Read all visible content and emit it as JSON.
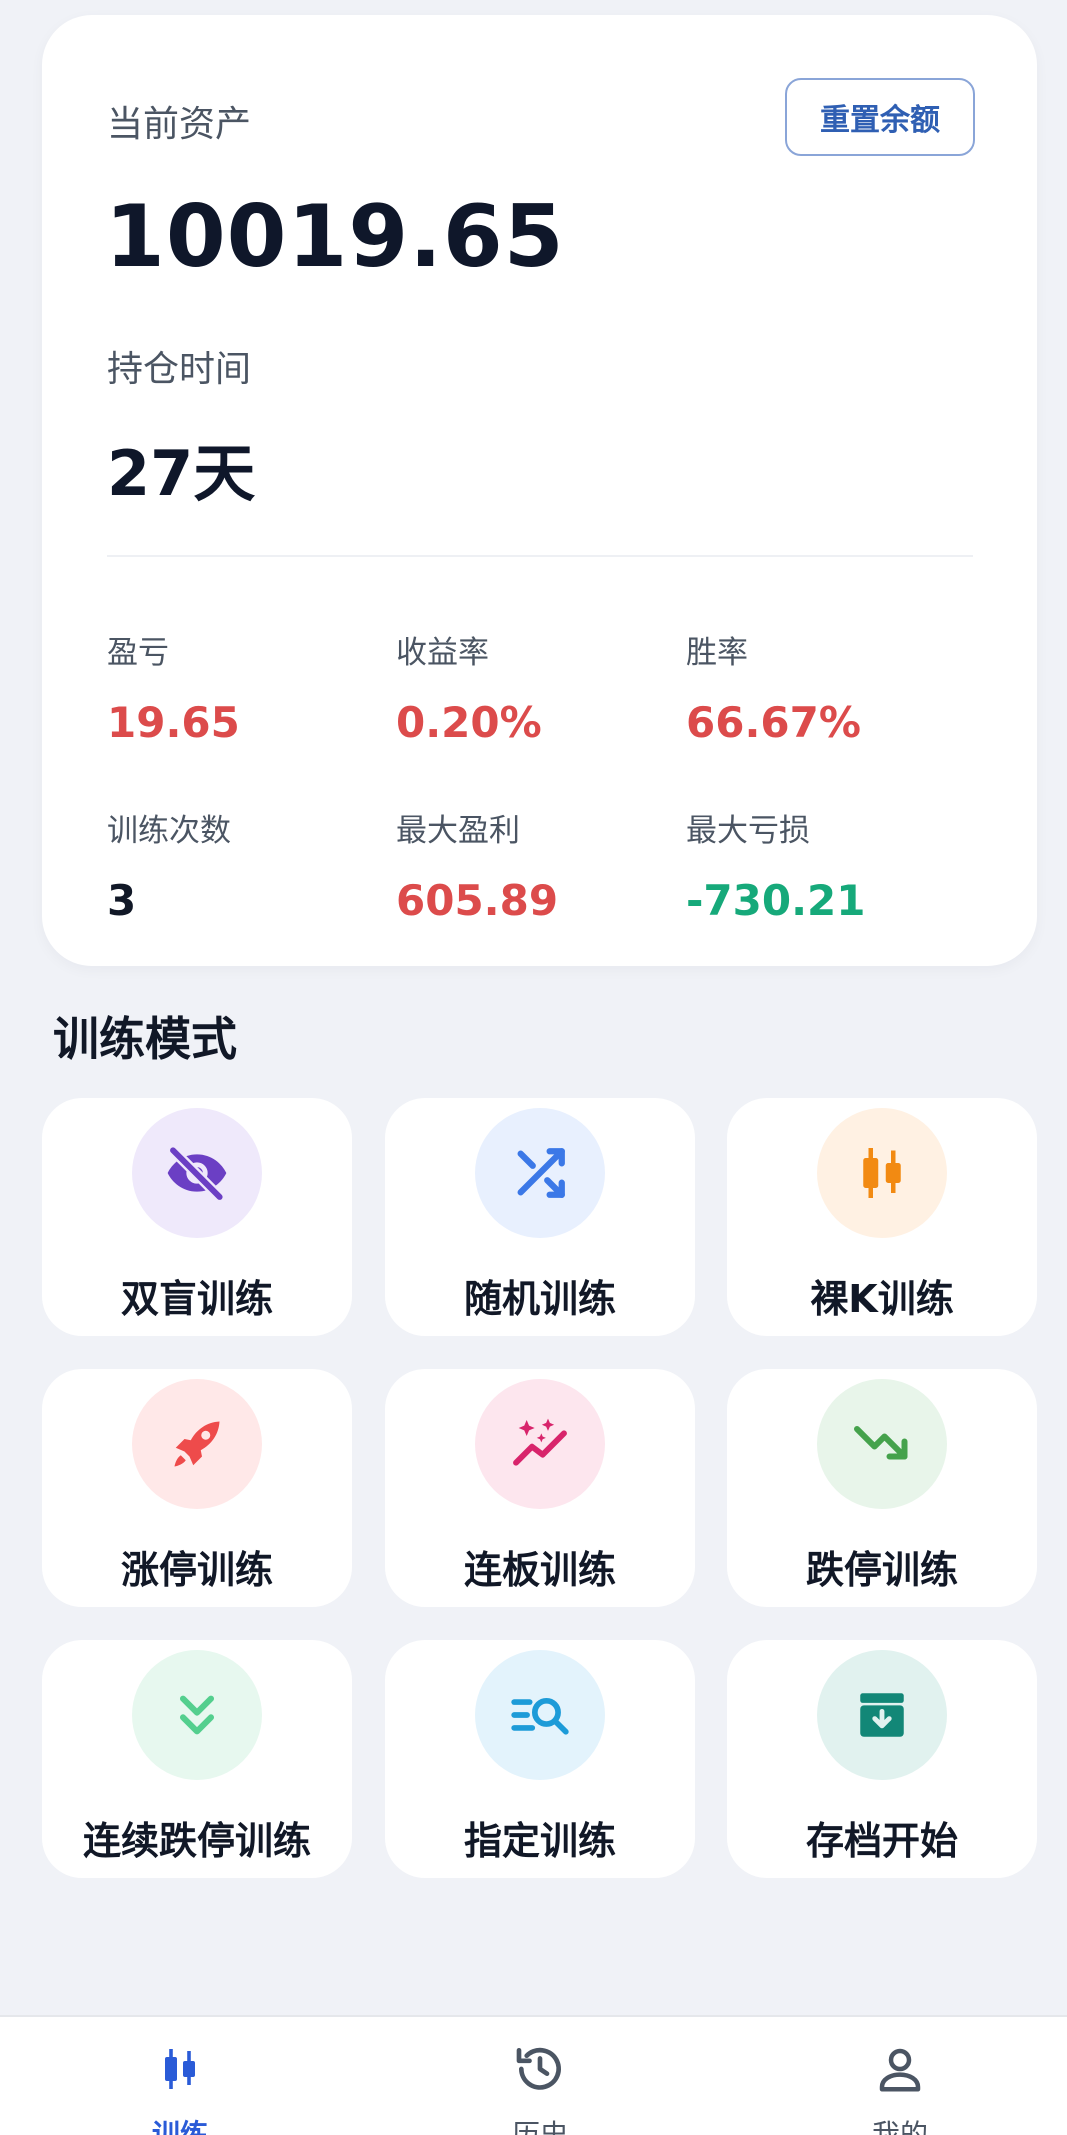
{
  "asset": {
    "label": "当前资产",
    "value": "10019.65",
    "reset_label": "重置余额",
    "hold_label": "持仓时间",
    "hold_value": "27天"
  },
  "stats": [
    {
      "label": "盈亏",
      "value": "19.65",
      "tone": "red"
    },
    {
      "label": "收益率",
      "value": "0.20%",
      "tone": "red"
    },
    {
      "label": "胜率",
      "value": "66.67%",
      "tone": "red"
    },
    {
      "label": "训练次数",
      "value": "3",
      "tone": "dark"
    },
    {
      "label": "最大盈利",
      "value": "605.89",
      "tone": "red"
    },
    {
      "label": "最大亏损",
      "value": "-730.21",
      "tone": "green"
    }
  ],
  "section": {
    "title": "训练模式"
  },
  "modes": [
    {
      "label": "双盲训练",
      "icon": "eye-slash-icon",
      "bg": "#efe9fb",
      "fg": "#6b3fc4"
    },
    {
      "label": "随机训练",
      "icon": "shuffle-icon",
      "bg": "#e8f0fe",
      "fg": "#3b78e7"
    },
    {
      "label": "裸K训练",
      "icon": "candlestick-icon",
      "bg": "#fff1e3",
      "fg": "#f28a12"
    },
    {
      "label": "涨停训练",
      "icon": "rocket-icon",
      "bg": "#ffe8e8",
      "fg": "#ee4b4b"
    },
    {
      "label": "连板训练",
      "icon": "sparkle-trend-icon",
      "bg": "#fde6ee",
      "fg": "#d8246b"
    },
    {
      "label": "跌停训练",
      "icon": "trending-down-icon",
      "bg": "#e8f5ea",
      "fg": "#45a24c"
    },
    {
      "label": "连续跌停训练",
      "icon": "double-chevron-down-icon",
      "bg": "#e7f8ef",
      "fg": "#54cf8e"
    },
    {
      "label": "指定训练",
      "icon": "list-search-icon",
      "bg": "#e3f3fc",
      "fg": "#1d9bd8"
    },
    {
      "label": "存档开始",
      "icon": "archive-icon",
      "bg": "#e1f2ef",
      "fg": "#128777"
    }
  ],
  "nav": [
    {
      "label": "训练",
      "icon": "candlestick-icon",
      "active": true
    },
    {
      "label": "历史",
      "icon": "history-icon",
      "active": false
    },
    {
      "label": "我的",
      "icon": "person-icon",
      "active": false
    }
  ],
  "colors": {
    "accent": "#2a5bd7",
    "profit": "#dc4b4b",
    "loss": "#16a97a",
    "background": "#f0f2f7"
  }
}
